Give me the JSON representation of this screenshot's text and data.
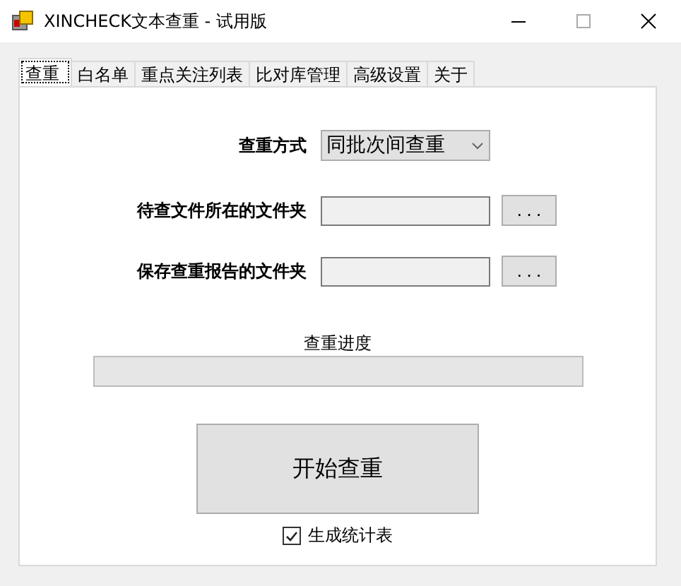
{
  "window": {
    "title": "XINCHECK文本查重 - 试用版"
  },
  "tabs": [
    {
      "label": "查重",
      "selected": true
    },
    {
      "label": "白名单",
      "selected": false
    },
    {
      "label": "重点关注列表",
      "selected": false
    },
    {
      "label": "比对库管理",
      "selected": false
    },
    {
      "label": "高级设置",
      "selected": false
    },
    {
      "label": "关于",
      "selected": false
    }
  ],
  "form": {
    "mode_label": "查重方式",
    "mode_value": "同批次间查重",
    "rows": [
      {
        "label": "待查文件所在的文件夹",
        "value": "",
        "browse": "..."
      },
      {
        "label": "保存查重报告的文件夹",
        "value": "",
        "browse": "..."
      }
    ],
    "progress_label": "查重进度",
    "progress": {
      "level": 0
    },
    "start_button": "开始查重",
    "stats_checkbox": {
      "label": "生成统计表",
      "checked": true
    }
  }
}
